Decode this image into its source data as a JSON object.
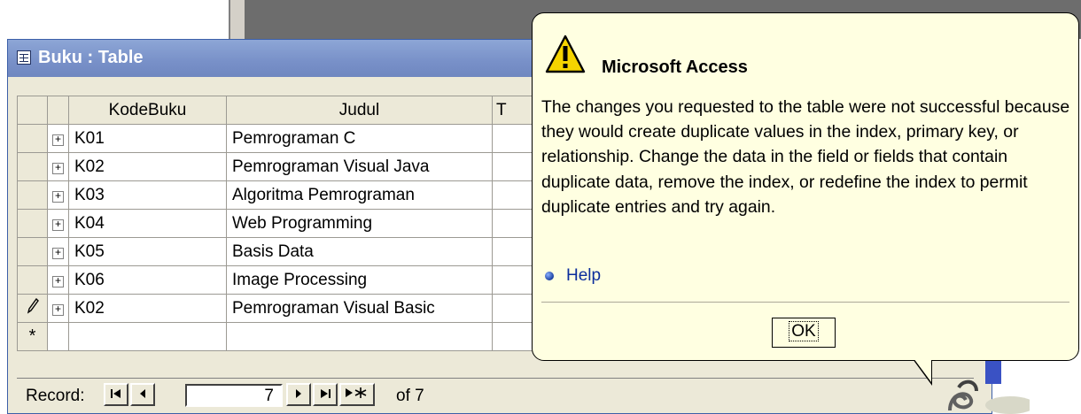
{
  "window": {
    "title": "Buku : Table"
  },
  "grid": {
    "columns": [
      "KodeBuku",
      "Judul",
      "T"
    ],
    "rows": [
      {
        "selector": "",
        "kode": "K01",
        "judul": "Pemrograman C"
      },
      {
        "selector": "",
        "kode": "K02",
        "judul": "Pemrograman Visual Java"
      },
      {
        "selector": "",
        "kode": "K03",
        "judul": "Algoritma Pemrograman"
      },
      {
        "selector": "",
        "kode": "K04",
        "judul": "Web Programming"
      },
      {
        "selector": "",
        "kode": "K05",
        "judul": "Basis Data"
      },
      {
        "selector": "",
        "kode": "K06",
        "judul": "Image Processing"
      },
      {
        "selector": "pencil",
        "kode": "K02",
        "judul": "Pemrograman Visual Basic"
      }
    ],
    "new_row_marker": "*"
  },
  "navigator": {
    "label": "Record:",
    "current": "7",
    "of_text": "of 7",
    "buttons": [
      "first-record",
      "previous-record",
      "next-record",
      "last-record",
      "new-record"
    ]
  },
  "dialog": {
    "title": "Microsoft Access",
    "message": "The changes you requested to the table were not successful because they would create duplicate values in the index, primary key, or relationship.  Change the data in the field or fields that contain duplicate data, remove the index, or redefine the index to permit duplicate entries and try again.",
    "help_label": "Help",
    "ok_label": "OK",
    "icon": "warning-icon"
  },
  "colors": {
    "titlebar": "#7890c8",
    "balloon": "#ffffe1",
    "help_link": "#0b2d9c"
  }
}
